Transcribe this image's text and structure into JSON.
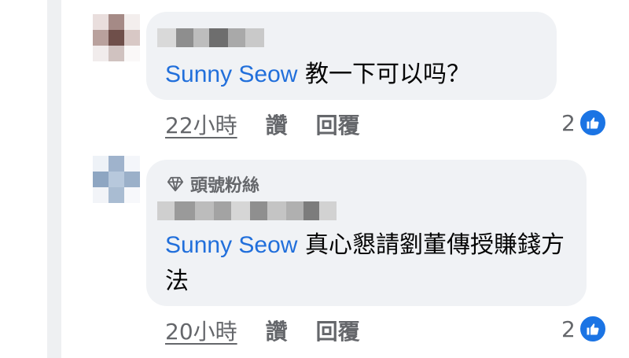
{
  "comments": [
    {
      "author": "",
      "mention": "Sunny Seow",
      "text": "教一下可以吗？",
      "time": "22小時",
      "like_label": "讚",
      "reply_label": "回覆",
      "reaction_count": "2",
      "reaction_icon": "like-icon"
    },
    {
      "badge": "頭號粉絲",
      "badge_icon": "diamond-icon",
      "author": "",
      "mention": "Sunny Seow",
      "text": "真心懇請劉董傳授賺錢方法",
      "time": "20小時",
      "like_label": "讚",
      "reply_label": "回覆",
      "reaction_count": "2",
      "reaction_icon": "like-icon"
    }
  ],
  "colors": {
    "mention": "#216fdb",
    "bubble": "#f0f2f5",
    "meta_text": "#65676b",
    "like_blue": "#1b74e4"
  }
}
